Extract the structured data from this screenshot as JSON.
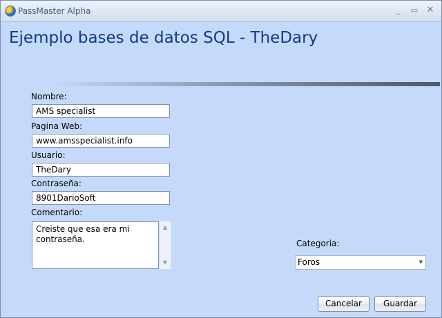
{
  "window": {
    "title": "PassMaster Alpha",
    "controls": {
      "minimize": "_",
      "maximize": "▭",
      "close": "✕"
    }
  },
  "heading": "Ejemplo bases de datos SQL - TheDary",
  "form": {
    "nombre": {
      "label": "Nombre:",
      "value": "AMS specialist"
    },
    "pagina_web": {
      "label": "Pagina Web:",
      "value": "www.amsspecialist.info"
    },
    "usuario": {
      "label": "Usuario:",
      "value": "TheDary"
    },
    "contrasena": {
      "label": "Contraseña:",
      "value": "8901DarioSoft"
    },
    "comentario": {
      "label": "Comentario:",
      "value": "Creiste que esa era mi contraseña."
    }
  },
  "categoria": {
    "label": "Categoria:",
    "selected": "Foros"
  },
  "buttons": {
    "cancel": "Cancelar",
    "save": "Guardar"
  }
}
